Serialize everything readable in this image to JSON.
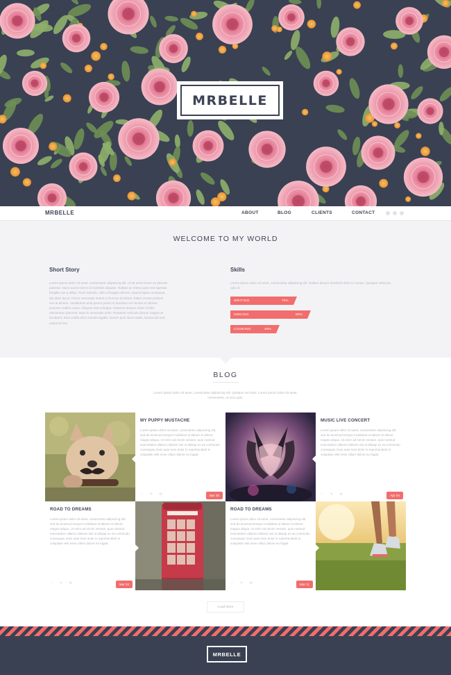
{
  "brand": "MRBELLE",
  "nav": {
    "items": [
      "ABOUT",
      "BLOG",
      "CLIENTS",
      "CONTACT"
    ]
  },
  "welcome": {
    "title": "WELCOME TO MY WORLD",
    "story_title": "Short Story",
    "story_text": "Lorem ipsum dolor sit amet, consectetur adipiscing elit. Ut sit amet lorem eu lobortis pulvinar. Nunc auctor lorem id molestie aliquam. Nullam ac metus quis erat egestas fringilla non a tellus. Proin lobortis, nibh id feugiat ultrices, mauris ligula consequat, dui diam lacus. Fusce venenatis metus a rhoncus tincidunt. Etiam ornare pretium orci at dictum. Vestibulum ante ipsum primis in faucibus orci luctus et ultrices posuere cubilia curae; Aliquam erat volutpat. Vivamus tempus dolor et felis elementum placerat. Nam in venenatis dolor. Praesent vehicula dictum magna at hendrerit. Duis mollis elit in iaculis sagittis. Donec quis risus mattis, lacinia dui sed, euismod nisi.",
    "skills_title": "Skills",
    "skills_text": "Lorem ipsum dolor sit amet, consectetur adipiscing elit. Nullam dictum hendrerit dolor in cursus. Quisque vehicula, odio id",
    "skills": [
      {
        "name": "WRITING",
        "percent_label": "70%",
        "value": 0.66
      },
      {
        "name": "SMILING",
        "percent_label": "80%",
        "value": 0.8
      },
      {
        "name": "COOKING",
        "percent_label": "40%",
        "value": 0.49
      }
    ],
    "colors": {
      "accent": "#f26d6d",
      "background": "#f3f3f6"
    }
  },
  "blog": {
    "title": "BLOG",
    "subtitle": "Lorem ipsum dolor sit amet, consectetur adipiscing elit. Quisque vel risus. Lorem ipsum dolor sit amet, consectetur, ut urna quis.",
    "posts": [
      {
        "title": "MY PUPPY MUSTACHE",
        "text": "Lorem ipsum dolor sit amet, consectetur adipiscing elit, sed do eiusmod tempor incididunt ut labore et dolore magna aliqua. Ut enim ad minim veniam, quis nostrud exercitation ullamco laboris nisi ut aliquip ex ea commodo consequat. Duis aute irure dolor in reprehenderit in voluptate velit esse cillum dolore eu fugiat.",
        "date": "Mar 28",
        "image": "puppy-with-mustache-photo"
      },
      {
        "title": "MUSIC LIVE CONCERT",
        "text": "Lorem ipsum dolor sit amet, consectetur adipiscing elit, sed do eiusmod tempor incididunt ut labore et dolore magna aliqua. Ut enim ad minim veniam, quis nostrud exercitation ullamco laboris nisi ut aliquip ex ea commodo consequat. Duis aute irure dolor in reprehenderit in voluptate velit esse cillum dolore eu fugiat.",
        "date": "Apr 04",
        "image": "heart-hands-concert-photo"
      },
      {
        "title": "ROAD TO DREAMS",
        "text": "Lorem ipsum dolor sit amet, consectetur adipiscing elit, sed do eiusmod tempor incididunt ut labore et dolore magna aliqua. Ut enim ad minim veniam, quis nostrud exercitation ullamco laboris nisi ut aliquip ex ea commodo consequat. Duis aute irure dolor in reprehenderit in voluptate velit esse cillum dolore eu fugiat.",
        "date": "Mar 24",
        "image": "red-telephone-booth-photo"
      },
      {
        "title": "ROAD TO DREAMS",
        "text": "Lorem ipsum dolor sit amet, consectetur adipiscing elit, sed do eiusmod tempor incididunt ut labore et dolore magna aliqua. Ut enim ad minim veniam, quis nostrud exercitation ullamco laboris nisi ut aliquip ex ea commodo consequat. Duis aute irure dolor in reprehenderit in voluptate velit esse cillum dolore eu fugiat.",
        "date": "Mar 11",
        "image": "runner-on-grass-photo"
      }
    ],
    "load_more": "Load More"
  },
  "footer": {
    "brand": "MRBELLE"
  }
}
